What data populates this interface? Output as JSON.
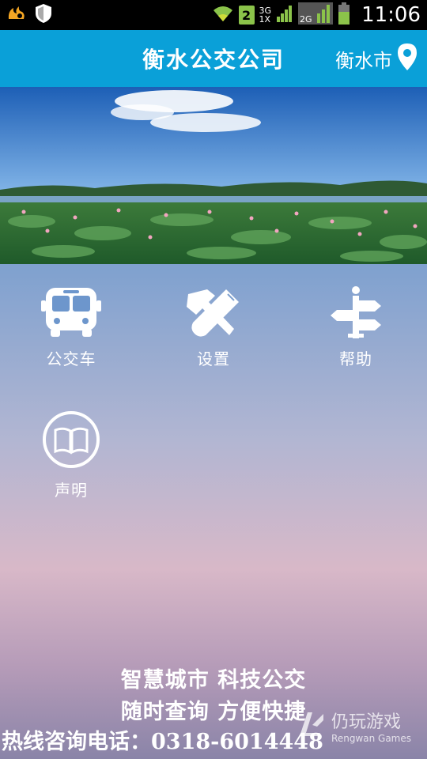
{
  "status_bar": {
    "sim_number": "2",
    "network_top": "3G",
    "network_bottom": "1X",
    "network2": "2G",
    "time": "11:06",
    "icons": [
      "uc-browser-icon",
      "shield-icon",
      "wifi-icon",
      "signal-icon",
      "battery-icon"
    ]
  },
  "header": {
    "title": "衡水公交公司",
    "city": "衡水市",
    "color": "#0aa0d8"
  },
  "menu": {
    "items": [
      {
        "label": "公交车",
        "icon": "bus-icon"
      },
      {
        "label": "设置",
        "icon": "tools-icon"
      },
      {
        "label": "帮助",
        "icon": "signpost-icon"
      },
      {
        "label": "声明",
        "icon": "book-icon"
      }
    ]
  },
  "footer": {
    "slogan1": "智慧城市  科技公交",
    "slogan2": "随时查询  方便快捷",
    "hotline": "热线咨询电话：0318-6014448"
  },
  "watermark": {
    "name_cn": "仍玩游戏",
    "name_en": "Rengwan Games"
  }
}
